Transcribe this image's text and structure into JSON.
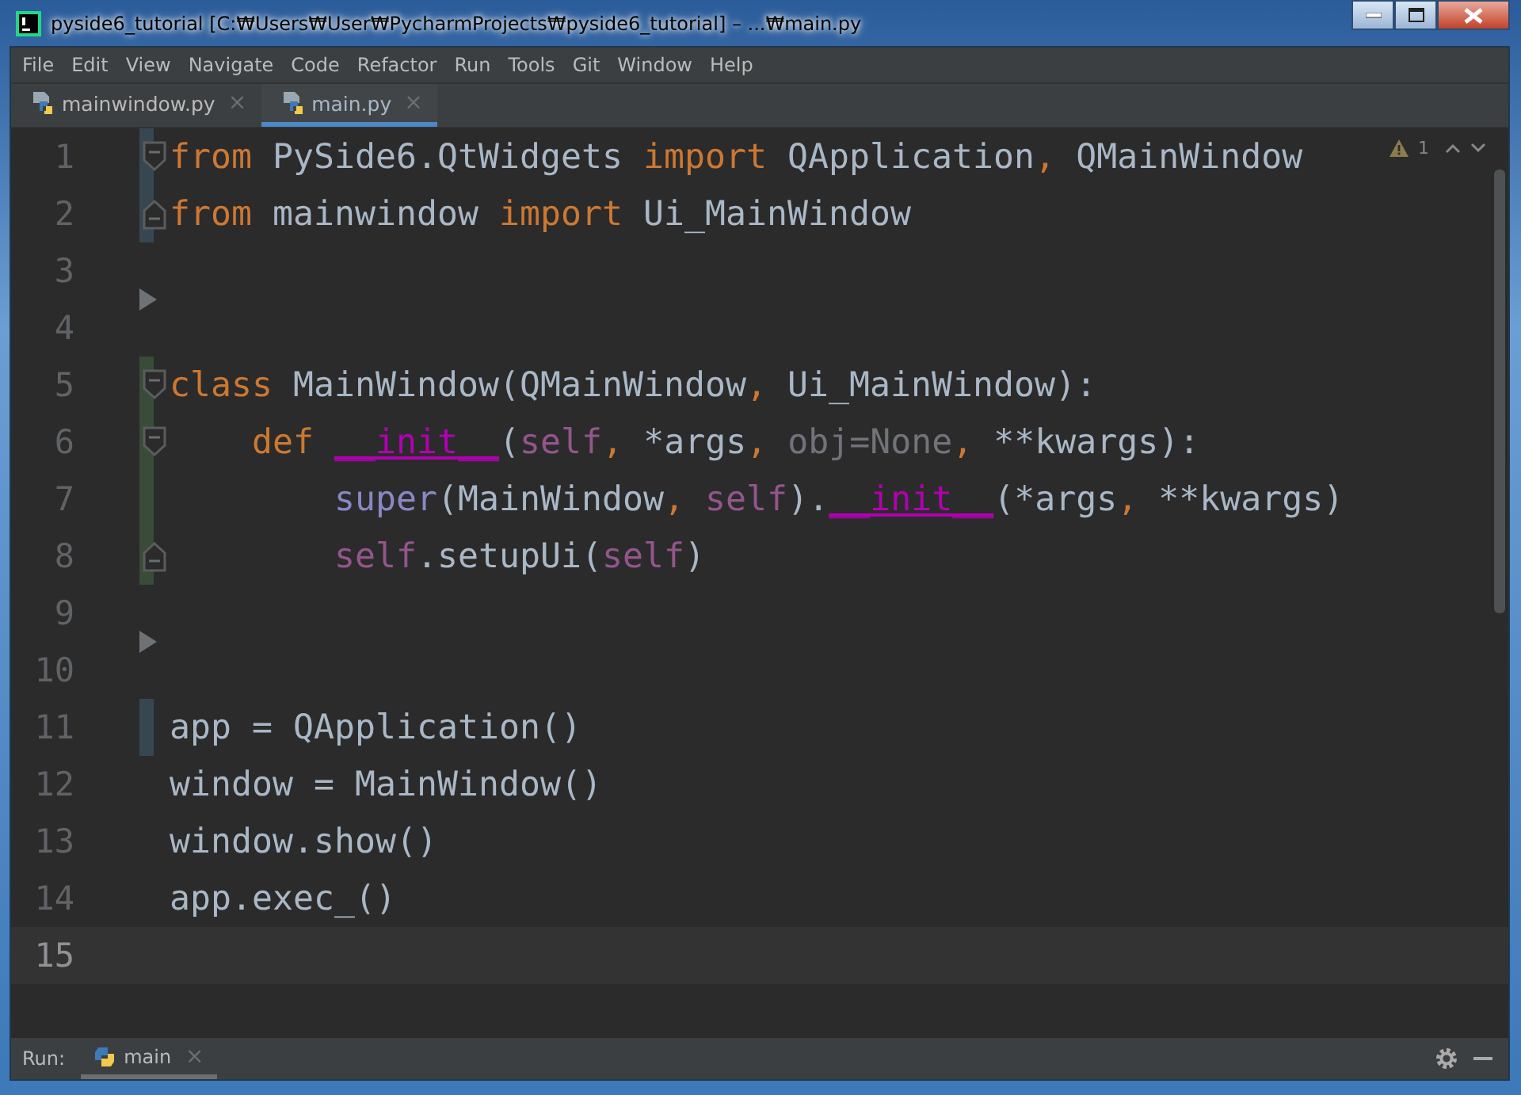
{
  "window": {
    "title": "pyside6_tutorial [C:₩Users₩User₩PycharmProjects₩pyside6_tutorial] – ...₩main.py"
  },
  "menu": [
    "File",
    "Edit",
    "View",
    "Navigate",
    "Code",
    "Refactor",
    "Run",
    "Tools",
    "Git",
    "Window",
    "Help"
  ],
  "tabs": [
    {
      "label": "mainwindow.py",
      "close": "×",
      "selected": false
    },
    {
      "label": "main.py",
      "close": "×",
      "selected": true
    }
  ],
  "inspections": {
    "warnings": "1"
  },
  "lines": [
    {
      "number": "1",
      "gutter_mark": {
        "kind": "modified"
      },
      "fold": {
        "kind": "start"
      },
      "current": false,
      "tokens": [
        {
          "t": "from",
          "kind": "kw"
        },
        {
          "t": " PySide6.QtWidgets ",
          "kind": "plain"
        },
        {
          "t": "import",
          "kind": "kw"
        },
        {
          "t": " QApplication",
          "kind": "plain"
        },
        {
          "t": ",",
          "kind": "kw"
        },
        {
          "t": " QMainWindow",
          "kind": "plain"
        }
      ]
    },
    {
      "number": "2",
      "gutter_mark": {
        "kind": "modified"
      },
      "fold": {
        "kind": "end"
      },
      "current": false,
      "tokens": [
        {
          "t": "from",
          "kind": "kw"
        },
        {
          "t": " mainwindow ",
          "kind": "plain"
        },
        {
          "t": "import",
          "kind": "kw"
        },
        {
          "t": " Ui_MainWindow",
          "kind": "plain"
        }
      ]
    },
    {
      "number": "3",
      "current": false,
      "marker": {
        "kind": "arrow"
      }
    },
    {
      "number": "4",
      "current": false
    },
    {
      "number": "5",
      "gutter_mark": {
        "kind": "added"
      },
      "fold": {
        "kind": "start"
      },
      "current": false,
      "tokens": [
        {
          "t": "class",
          "kind": "kw"
        },
        {
          "t": " MainWindow(QMainWindow",
          "kind": "plain"
        },
        {
          "t": ",",
          "kind": "kw"
        },
        {
          "t": " Ui_MainWindow):",
          "kind": "plain"
        }
      ]
    },
    {
      "number": "6",
      "gutter_mark": {
        "kind": "added"
      },
      "fold": {
        "kind": "start"
      },
      "current": false,
      "tokens": [
        {
          "t": "    def ",
          "kind": "kw"
        },
        {
          "t": "__init__",
          "kind": "magic"
        },
        {
          "t": "(",
          "kind": "plain"
        },
        {
          "t": "self",
          "kind": "self"
        },
        {
          "t": ",",
          "kind": "kw"
        },
        {
          "t": " *args",
          "kind": "plain"
        },
        {
          "t": ",",
          "kind": "kw"
        },
        {
          "t": " obj=None",
          "kind": "unused"
        },
        {
          "t": ",",
          "kind": "kw"
        },
        {
          "t": " **kwargs):",
          "kind": "plain"
        }
      ]
    },
    {
      "number": "7",
      "gutter_mark": {
        "kind": "added"
      },
      "current": false,
      "tokens": [
        {
          "t": "        super",
          "kind": "builtin"
        },
        {
          "t": "(MainWindow",
          "kind": "plain"
        },
        {
          "t": ", ",
          "kind": "kw"
        },
        {
          "t": "self",
          "kind": "self"
        },
        {
          "t": ").",
          "kind": "plain"
        },
        {
          "t": "__init__",
          "kind": "magic"
        },
        {
          "t": "(*args",
          "kind": "plain"
        },
        {
          "t": ",",
          "kind": "kw"
        },
        {
          "t": " **kwargs)",
          "kind": "plain"
        }
      ]
    },
    {
      "number": "8",
      "gutter_mark": {
        "kind": "added"
      },
      "fold": {
        "kind": "end"
      },
      "current": false,
      "tokens": [
        {
          "t": "        self",
          "kind": "self"
        },
        {
          "t": ".setupUi(",
          "kind": "plain"
        },
        {
          "t": "self",
          "kind": "self"
        },
        {
          "t": ")",
          "kind": "plain"
        }
      ]
    },
    {
      "number": "9",
      "current": false,
      "marker": {
        "kind": "arrow"
      }
    },
    {
      "number": "10",
      "current": false
    },
    {
      "number": "11",
      "gutter_mark": {
        "kind": "modified"
      },
      "current": false,
      "tokens": [
        {
          "t": "app = QApplication()",
          "kind": "plain"
        }
      ]
    },
    {
      "number": "12",
      "current": false,
      "tokens": [
        {
          "t": "window = MainWindow()",
          "kind": "plain"
        }
      ]
    },
    {
      "number": "13",
      "current": false,
      "tokens": [
        {
          "t": "window.show()",
          "kind": "plain"
        }
      ]
    },
    {
      "number": "14",
      "current": false,
      "tokens": [
        {
          "t": "app.exec_()",
          "kind": "plain"
        }
      ]
    },
    {
      "number": "15",
      "current": true
    }
  ],
  "run_bar": {
    "label": "Run:",
    "tab": "main",
    "close": "×"
  }
}
